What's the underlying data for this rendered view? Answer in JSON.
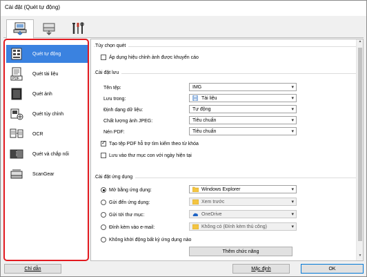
{
  "window": {
    "title": "Cài đặt (Quét tự động)"
  },
  "tabs": [
    {
      "icon": "scan-from-computer-icon"
    },
    {
      "icon": "scan-from-panel-icon"
    },
    {
      "icon": "general-settings-icon"
    }
  ],
  "sidebar": {
    "items": [
      {
        "label": "Quét tự động",
        "icon": "auto-scan-icon",
        "selected": true
      },
      {
        "label": "Quét tài liệu",
        "icon": "document-scan-icon"
      },
      {
        "label": "Quét ảnh",
        "icon": "photo-scan-icon"
      },
      {
        "label": "Quét tùy chỉnh",
        "icon": "custom-scan-icon"
      },
      {
        "label": "OCR",
        "icon": "ocr-icon"
      },
      {
        "label": "Quét và chắp nối",
        "icon": "stitch-scan-icon"
      },
      {
        "label": "ScanGear",
        "icon": "scangear-icon"
      }
    ]
  },
  "scan_options": {
    "title": "Tùy chọn quét",
    "apply_correction": "Áp dụng hiệu chỉnh ảnh được khuyến cáo"
  },
  "save_settings": {
    "title": "Cài đặt lưu",
    "file_name_label": "Tên tệp:",
    "file_name_value": "IMG",
    "save_in_label": "Lưu trong:",
    "save_in_value": "Tài liệu",
    "data_format_label": "Định dạng dữ liệu:",
    "data_format_value": "Tự động",
    "jpeg_quality_label": "Chất lượng ảnh JPEG:",
    "jpeg_quality_value": "Tiêu chuẩn",
    "pdf_compression_label": "Nén PDF:",
    "pdf_compression_value": "Tiêu chuẩn",
    "create_searchable_pdf": "Tạo tệp PDF hỗ trợ tìm kiếm theo từ khóa",
    "save_subfolder": "Lưu vào thư mục con với ngày hiện tại"
  },
  "app_settings": {
    "title": "Cài đặt ứng dụng",
    "open_with_label": "Mở bằng ứng dụng:",
    "open_with_value": "Windows Explorer",
    "send_to_app_label": "Gửi đến ứng dụng:",
    "send_to_app_value": "Xem trước",
    "send_to_folder_label": "Gửi tới thư mục:",
    "send_to_folder_value": "OneDrive",
    "attach_email_label": "Đính kèm vào e-mail:",
    "attach_email_value": "Không có (Đính kèm thủ công)",
    "dont_start_label": "Không khởi động bất kỳ ứng dụng nào",
    "more_functions_button": "Thêm chức năng"
  },
  "footer": {
    "instructions_button": "Chỉ dẫn",
    "defaults_button": "Mặc định",
    "ok_button": "OK"
  }
}
